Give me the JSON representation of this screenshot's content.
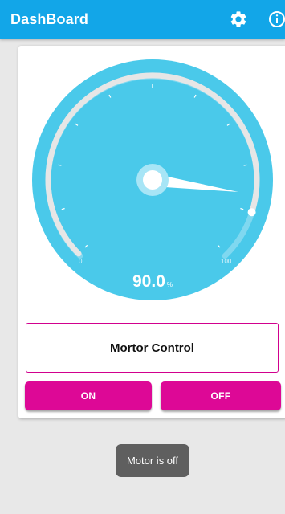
{
  "appbar": {
    "title": "DashBoard",
    "icons": [
      "gear-icon",
      "info-icon"
    ],
    "color": "#12a6e8"
  },
  "gauge": {
    "value": 90.0,
    "value_text": "90.0",
    "unit": "%",
    "min_label": "0",
    "max_label": "100",
    "min": 0,
    "max": 100,
    "color": "#4ac9ea"
  },
  "control": {
    "title": "Mortor Control",
    "on_label": "ON",
    "off_label": "OFF",
    "accent": "#dd0896"
  },
  "toast": {
    "message": "Motor is off"
  }
}
